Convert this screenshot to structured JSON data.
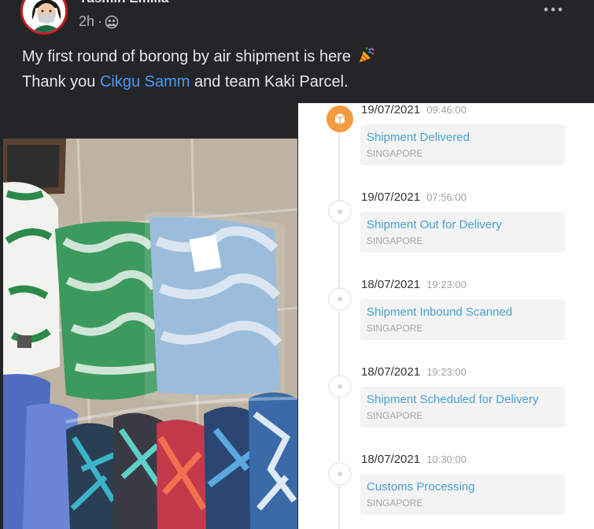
{
  "post": {
    "author_name": "Yasmin Emilia",
    "time_ago": "2h",
    "separator": "·",
    "privacy_icon": "friends-icon",
    "more_icon": "more-dots-icon",
    "text_line1": "My first round of borong by air shipment is here",
    "emoji": "party-popper-icon",
    "text_line2_prefix": "Thank you",
    "mention": "Cikgu Samm",
    "text_line2_suffix": "and team Kaki Parcel."
  },
  "tracking": {
    "delivered_icon": "package-icon",
    "entries": [
      {
        "date": "19/07/2021",
        "time": "09:46:00",
        "status": "Shipment Delivered",
        "location": "SINGAPORE"
      },
      {
        "date": "19/07/2021",
        "time": "07:56:00",
        "status": "Shipment Out for Delivery",
        "location": "SINGAPORE"
      },
      {
        "date": "18/07/2021",
        "time": "19:23:00",
        "status": "Shipment Inbound Scanned",
        "location": "SINGAPORE"
      },
      {
        "date": "18/07/2021",
        "time": "19:23:00",
        "status": "Shipment Scheduled for Delivery",
        "location": "SINGAPORE"
      },
      {
        "date": "18/07/2021",
        "time": "10:30:00",
        "status": "Customs Processing",
        "location": "SINGAPORE"
      }
    ]
  },
  "colors": {
    "background": "#242526",
    "text": "#e4e6eb",
    "secondary": "#b0b3b8",
    "link": "#4599ff",
    "status_blue": "#4a9fd2",
    "marker_orange": "#f49a3f"
  }
}
